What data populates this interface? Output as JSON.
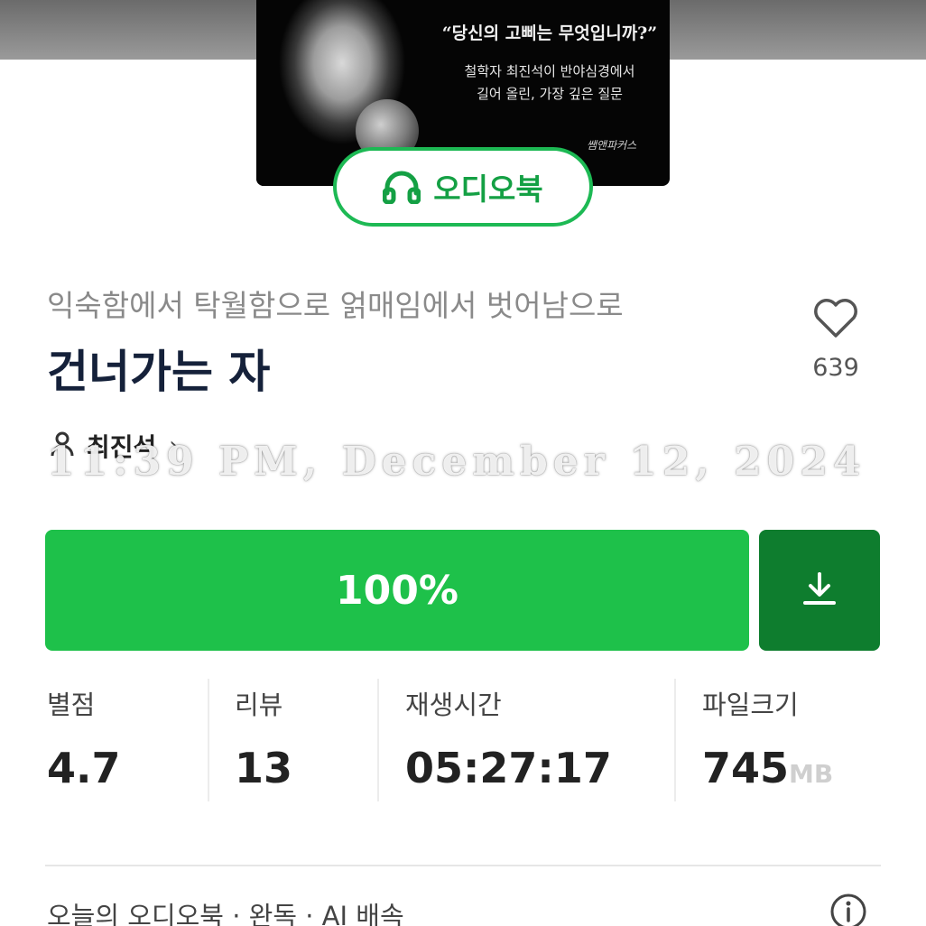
{
  "cover": {
    "quote": "“당신의 고삐는 무엇입니까?”",
    "line1": "철학자 최진석이 반야심경에서",
    "line2": "길어 올린, 가장 깊은 질문",
    "publisher": "쌤앤파커스"
  },
  "badge": {
    "label": "오디오북",
    "icon": "headphones-icon"
  },
  "book": {
    "subtitle": "익숙함에서 탁월함으로 얽매임에서 벗어남으로",
    "title": "건너가는 자",
    "author": "최진석",
    "author_chevron": "›"
  },
  "like": {
    "count": "639",
    "icon": "heart-outline-icon"
  },
  "overlay": {
    "timestamp": "11:39 PM, December 12, 2024"
  },
  "actions": {
    "progress_label": "100%",
    "progress": 1.0,
    "download_icon": "download-icon"
  },
  "stats": {
    "rating": {
      "label": "별점",
      "value": "4.7"
    },
    "reviews": {
      "label": "리뷰",
      "value": "13"
    },
    "duration": {
      "label": "재생시간",
      "value": "05:27:17"
    },
    "filesize": {
      "label": "파일크기",
      "value": "745",
      "unit": "MB"
    }
  },
  "footer": {
    "text": "오늘의 오디오북 · 완독 · AI 배속",
    "icon": "info-icon"
  },
  "colors": {
    "accent": "#1ec14a",
    "accent_dark": "#0e7d2e",
    "title": "#15213a",
    "badge_border": "#1db954"
  }
}
